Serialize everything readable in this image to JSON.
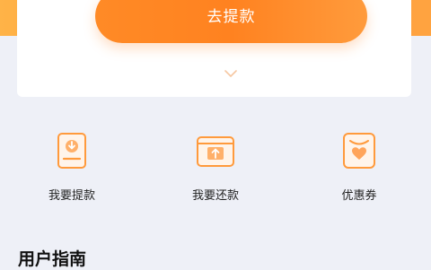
{
  "card": {
    "withdraw_button": "去提款",
    "expand_icon": "chevron-down-icon"
  },
  "quick_actions": [
    {
      "label": "我要提款",
      "icon": "withdraw-document-icon"
    },
    {
      "label": "我要还款",
      "icon": "repay-upload-icon"
    },
    {
      "label": "优惠券",
      "icon": "coupon-heart-icon"
    }
  ],
  "guide": {
    "title": "用户指南"
  },
  "colors": {
    "accent": "#ff8a26",
    "accent_light": "#ffb347",
    "background": "#eef0f7"
  }
}
